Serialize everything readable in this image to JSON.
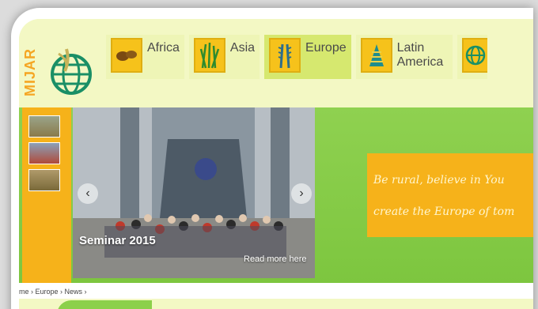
{
  "brand": {
    "vertical_text": "MIJAR"
  },
  "regions": [
    {
      "label": "Africa",
      "icon": "coffee-beans-icon",
      "active": false
    },
    {
      "label": "Asia",
      "icon": "rice-plant-icon",
      "active": false
    },
    {
      "label": "Europe",
      "icon": "wheat-icon",
      "active": true
    },
    {
      "label": "Latin America",
      "icon": "corn-icon",
      "active": false
    },
    {
      "label": "",
      "icon": "globe-icon",
      "active": false
    }
  ],
  "slider": {
    "title": "Seminar 2015",
    "read_more": "Read more here",
    "prev": "‹",
    "next": "›"
  },
  "tagline": {
    "line1": "Be rural, believe in You",
    "line2": "create the Europe of tom"
  },
  "breadcrumb": "me › Europe › News ›",
  "colors": {
    "accent_orange": "#f6b21a",
    "green": "#8fd150",
    "header_bg": "#f3f8c4"
  }
}
